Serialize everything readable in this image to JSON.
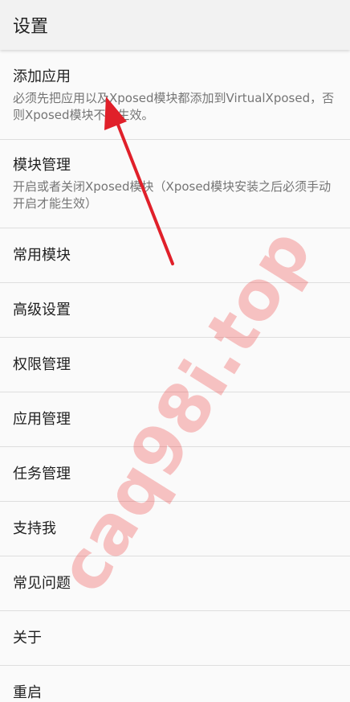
{
  "appbar": {
    "title": "设置"
  },
  "settings": {
    "items": [
      {
        "title": "添加应用",
        "summary": "必须先把应用以及Xposed模块都添加到VirtualXposed，否则Xposed模块不会生效。"
      },
      {
        "title": "模块管理",
        "summary": "开启或者关闭Xposed模块（Xposed模块安装之后必须手动开启才能生效）"
      },
      {
        "title": "常用模块"
      },
      {
        "title": "高级设置"
      },
      {
        "title": "权限管理"
      },
      {
        "title": "应用管理"
      },
      {
        "title": "任务管理"
      },
      {
        "title": "支持我"
      },
      {
        "title": "常见问题"
      },
      {
        "title": "关于"
      },
      {
        "title": "重启"
      }
    ]
  },
  "watermark": {
    "text": "caq98i.top",
    "color": "#ee2a2a"
  },
  "annotation": {
    "arrow_color": "#e0202a"
  }
}
